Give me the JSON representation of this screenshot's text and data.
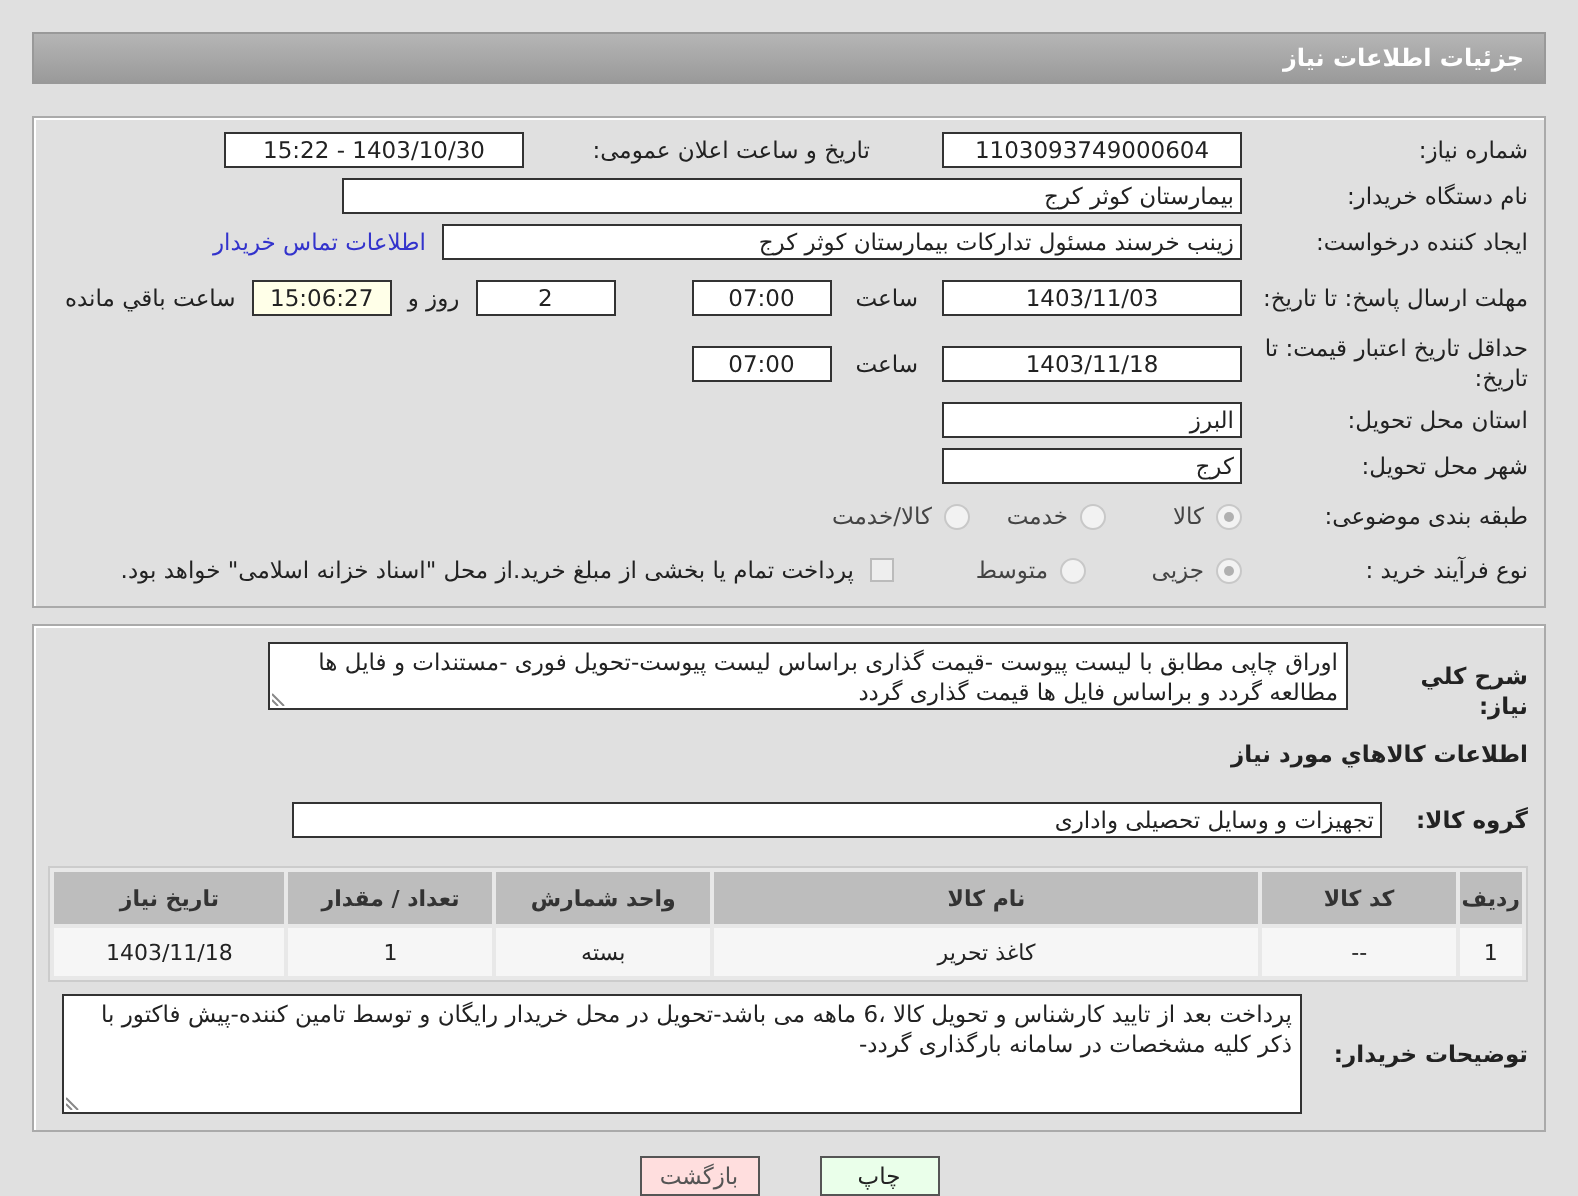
{
  "header": {
    "title": "جزئیات اطلاعات نیاز"
  },
  "need_number": {
    "label": "شماره نیاز:",
    "value": "1103093749000604"
  },
  "announce": {
    "label": "تاریخ و ساعت اعلان عمومی:",
    "value": "1403/10/30 - 15:22"
  },
  "buyer_org": {
    "label": "نام دستگاه خریدار:",
    "value": "بیمارستان کوثر کرج"
  },
  "creator": {
    "label": "ایجاد کننده درخواست:",
    "value": "زینب خرسند مسئول تدارکات بیمارستان کوثر کرج",
    "link": "اطلاعات تماس خریدار"
  },
  "deadline": {
    "label": "مهلت ارسال پاسخ: تا تاریخ:",
    "date": "1403/11/03",
    "time_label": "ساعت",
    "time": "07:00",
    "days": "2",
    "days_label": "روز و",
    "remaining": "15:06:27",
    "remaining_label": "ساعت باقي مانده"
  },
  "validity": {
    "label": "حداقل تاریخ اعتبار قیمت: تا تاریخ:",
    "date": "1403/11/18",
    "time_label": "ساعت",
    "time": "07:00"
  },
  "province": {
    "label": "استان محل تحویل:",
    "value": "البرز"
  },
  "city": {
    "label": "شهر محل تحویل:",
    "value": "کرج"
  },
  "category": {
    "label": "طبقه بندی موضوعی:",
    "options": [
      {
        "label": "کالا",
        "selected": true
      },
      {
        "label": "خدمت",
        "selected": false
      },
      {
        "label": "کالا/خدمت",
        "selected": false
      }
    ]
  },
  "purchase_type": {
    "label": "نوع فرآیند خرید :",
    "options": [
      {
        "label": "جزیی",
        "selected": true
      },
      {
        "label": "متوسط",
        "selected": false
      }
    ],
    "treasury": {
      "label": "پرداخت تمام یا بخشی از مبلغ خرید.از محل \"اسناد خزانه اسلامی\" خواهد بود.",
      "checked": false
    }
  },
  "description": {
    "label": "شرح کلي نياز:",
    "value": "اوراق چاپی مطابق با لیست پیوست -قیمت گذاری براساس لیست پیوست-تحویل فوری -مستندات و فایل ها مطالعه گردد و براساس فایل ها قیمت گذاری گردد"
  },
  "goods_title": "اطلاعات کالاهاي مورد نياز",
  "goods_group": {
    "label": "گروه کالا:",
    "value": "تجهیزات و وسایل تحصیلی واداری"
  },
  "table": {
    "columns": [
      "ردیف",
      "کد کالا",
      "نام کالا",
      "واحد شمارش",
      "تعداد / مقدار",
      "تاریخ نیاز"
    ],
    "rows": [
      [
        "1",
        "--",
        "کاغذ تحریر",
        "بسته",
        "1",
        "1403/11/18"
      ]
    ]
  },
  "buyer_notes": {
    "label": "توضیحات خریدار:",
    "value": "پرداخت بعد از تایید کارشناس و تحویل کالا ،6 ماهه می باشد-تحویل در محل خریدار رایگان و توسط تامین کننده-پیش فاکتور با ذکر کلیه مشخصات در سامانه بارگذاری گردد-"
  },
  "buttons": [
    {
      "label": "چاپ",
      "kind": "print"
    },
    {
      "label": "بازگشت",
      "kind": "back"
    }
  ]
}
